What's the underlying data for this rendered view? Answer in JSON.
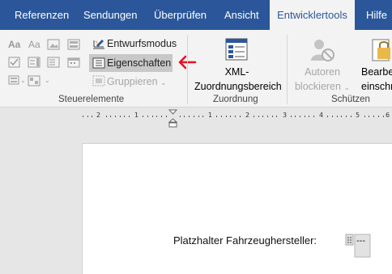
{
  "tabs": [
    {
      "label": "Referenzen",
      "active": false
    },
    {
      "label": "Sendungen",
      "active": false
    },
    {
      "label": "Überprüfen",
      "active": false
    },
    {
      "label": "Ansicht",
      "active": false
    },
    {
      "label": "Entwicklertools",
      "active": true
    },
    {
      "label": "Hilfe",
      "active": false
    }
  ],
  "ribbon": {
    "steuerelemente": {
      "label": "Steuerelemente",
      "entwurfsmodus": "Entwurfsmodus",
      "eigenschaften": "Eigenschaften",
      "gruppieren": "Gruppieren"
    },
    "zuordnung": {
      "label": "Zuordnung",
      "xml_line1": "XML-",
      "xml_line2": "Zuordnungsbereich"
    },
    "schuetzen": {
      "label": "Schützen",
      "autoren_line1": "Autoren",
      "autoren_line2": "blockieren",
      "bearbeiten_line1": "Bearbeitu",
      "bearbeiten_line2": "einschr"
    }
  },
  "ruler": {
    "left_numbers": [
      "2",
      "1"
    ],
    "right_numbers": [
      "1",
      "2",
      "3",
      "4",
      "5",
      "6"
    ]
  },
  "document": {
    "placeholder_label": "Platzhalter Fahrzeughersteller:",
    "content_control_text": "---"
  },
  "colors": {
    "tab_bar": "#2b579a",
    "ribbon_bg": "#f3f3f3",
    "highlight": "#c8c8c8",
    "arrow": "#e81123"
  }
}
